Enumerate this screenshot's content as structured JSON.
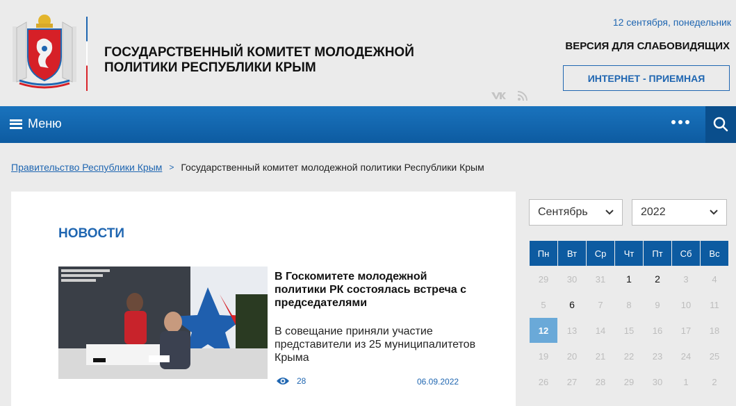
{
  "header": {
    "org_title_line1": "ГОСУДАРСТВЕННЫЙ КОМИТЕТ МОЛОДЕЖНОЙ",
    "org_title_line2": "ПОЛИТИКИ РЕСПУБЛИКИ КРЫМ",
    "date": "12 сентября, понедельник",
    "impaired_label": "ВЕРСИЯ ДЛЯ СЛАБОВИДЯЩИХ",
    "reception_label": "ИНТЕРНЕТ - ПРИЕМНАЯ",
    "social": [
      "vk-icon",
      "rss-icon"
    ],
    "social_vk_text": "VK"
  },
  "nav": {
    "menu_label": "Меню",
    "more_icon": "ellipsis-icon",
    "search_icon": "search-icon"
  },
  "breadcrumb": {
    "parent": "Правительство Республики Крым",
    "separator": ">",
    "current": "Государственный комитет молодежной политики Республики Крым"
  },
  "news": {
    "heading": "НОВОСТИ",
    "items": [
      {
        "title": "В Госкомитете молодежной политики РК состоялась встреча с председателями",
        "description": "В совещание приняли участие представители из 25 муниципалитетов Крыма",
        "views": "28",
        "date": "06.09.2022"
      }
    ]
  },
  "calendar": {
    "month": "Сентябрь",
    "year": "2022",
    "weekdays": [
      "Пн",
      "Вт",
      "Ср",
      "Чт",
      "Пт",
      "Сб",
      "Вс"
    ],
    "weeks": [
      [
        "29",
        "30",
        "31",
        "1",
        "2",
        "3",
        "4"
      ],
      [
        "5",
        "6",
        "7",
        "8",
        "9",
        "10",
        "11"
      ],
      [
        "12",
        "13",
        "14",
        "15",
        "16",
        "17",
        "18"
      ],
      [
        "19",
        "20",
        "21",
        "22",
        "23",
        "24",
        "25"
      ],
      [
        "26",
        "27",
        "28",
        "29",
        "30",
        "1",
        "2"
      ]
    ],
    "today": "12",
    "colors": {
      "header": "#0d5ba1",
      "today": "#6aa9d8",
      "accent": "#1f66b1"
    }
  }
}
